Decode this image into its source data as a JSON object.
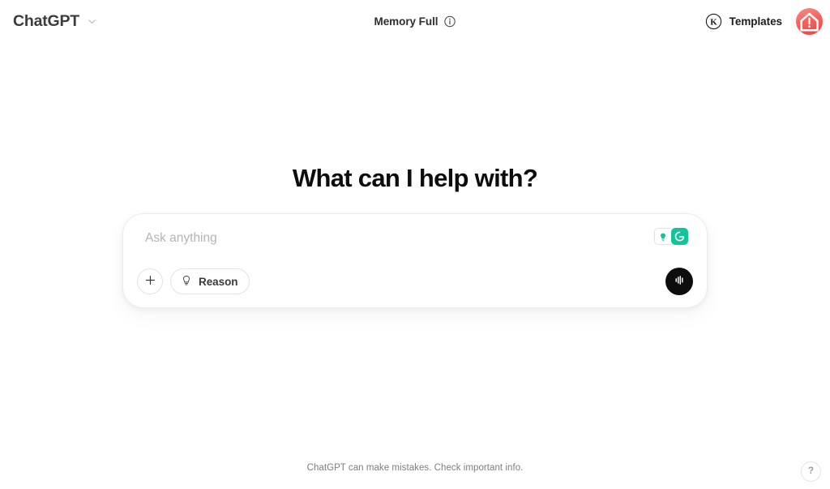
{
  "topbar": {
    "brand": {
      "label": "ChatGPT",
      "chevron_icon": "chevron-down-icon"
    },
    "memory": {
      "label": "Memory Full",
      "info_icon": "info-circle-icon"
    },
    "templates": {
      "badge_letter": "K",
      "badge_icon": "circled-k-icon",
      "label": "Templates"
    },
    "avatar": {
      "icon": "home-alert-avatar-icon",
      "color": "#f4635e",
      "color_light": "#fb8d89"
    }
  },
  "main": {
    "headline": "What can I help with?",
    "composer": {
      "placeholder": "Ask anything",
      "value": "",
      "grammarly": {
        "bulb_icon": "grammarly-lightbulb-icon",
        "logo_icon": "grammarly-g-icon",
        "accent_color": "#15c39a"
      },
      "tools": {
        "add_icon": "plus-icon",
        "add_label": "",
        "reason_icon": "lightbulb-icon",
        "reason_label": "Reason"
      },
      "voice": {
        "icon": "voice-waveform-icon",
        "color": "#0d0d0d"
      }
    }
  },
  "footer": {
    "disclaimer": "ChatGPT can make mistakes. Check important info.",
    "help": {
      "glyph": "?",
      "icon": "help-question-icon"
    }
  }
}
